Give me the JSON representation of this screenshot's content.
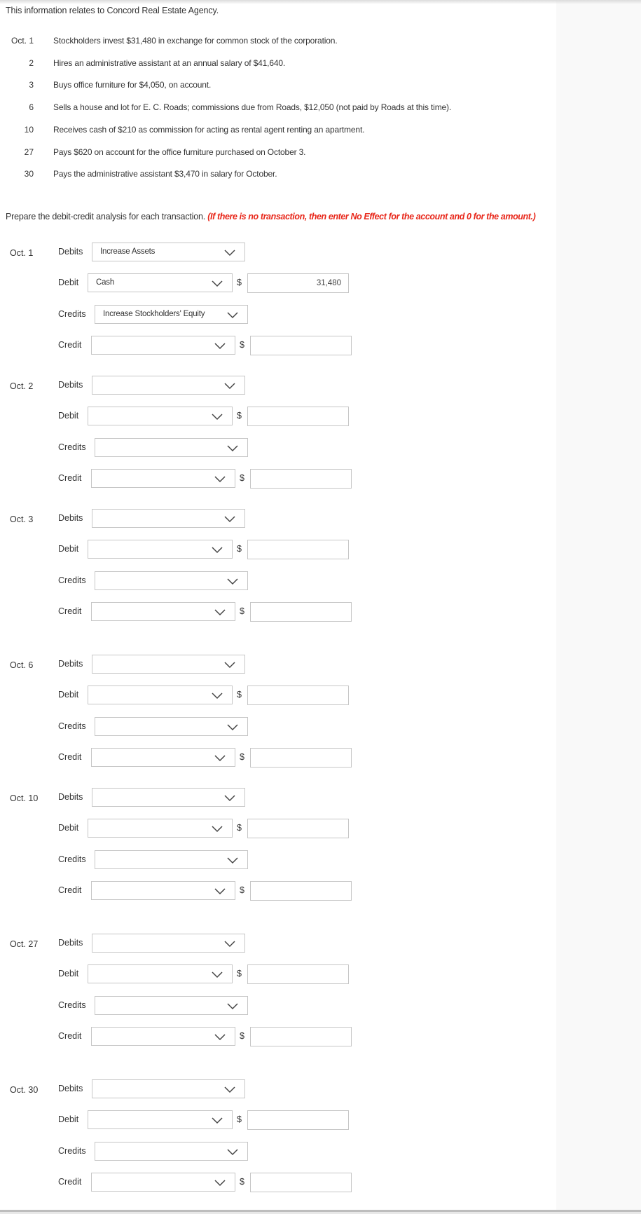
{
  "intro": "This information relates to Concord Real Estate Agency.",
  "transactions": [
    {
      "date": "Oct. 1",
      "description": "Stockholders invest $31,480 in exchange for common stock of the corporation."
    },
    {
      "date": "2",
      "description": "Hires an administrative assistant at an annual salary of $41,640."
    },
    {
      "date": "3",
      "description": "Buys office furniture for $4,050, on account."
    },
    {
      "date": "6",
      "description": "Sells a house and lot for E. C. Roads; commissions due from Roads, $12,050 (not paid by Roads at this time)."
    },
    {
      "date": "10",
      "description": "Receives cash of $210 as commission for acting as rental agent renting an apartment."
    },
    {
      "date": "27",
      "description": "Pays $620 on account for the office furniture purchased on October 3."
    },
    {
      "date": "30",
      "description": "Pays the administrative assistant $3,470 in salary for October."
    }
  ],
  "instructions": {
    "text": "Prepare the debit-credit analysis for each transaction.",
    "note": "(If there is no transaction, then enter No Effect for the account and 0 for the amount.)"
  },
  "labels": {
    "debits": "Debits",
    "debit": "Debit",
    "credits": "Credits",
    "credit": "Credit",
    "currency": "$"
  },
  "sections": [
    {
      "date": "Oct. 1",
      "debits": "Increase Assets",
      "debit_account": "Cash",
      "debit_amount": "31,480",
      "credits": "Increase Stockholders' Equity",
      "credit_account": "",
      "credit_amount": ""
    },
    {
      "date": "Oct. 2",
      "debits": "",
      "debit_account": "",
      "debit_amount": "",
      "credits": "",
      "credit_account": "",
      "credit_amount": ""
    },
    {
      "date": "Oct. 3",
      "debits": "",
      "debit_account": "",
      "debit_amount": "",
      "credits": "",
      "credit_account": "",
      "credit_amount": ""
    },
    {
      "date": "Oct. 6",
      "debits": "",
      "debit_account": "",
      "debit_amount": "",
      "credits": "",
      "credit_account": "",
      "credit_amount": ""
    },
    {
      "date": "Oct. 10",
      "debits": "",
      "debit_account": "",
      "debit_amount": "",
      "credits": "",
      "credit_account": "",
      "credit_amount": ""
    },
    {
      "date": "Oct. 27",
      "debits": "",
      "debit_account": "",
      "debit_amount": "",
      "credits": "",
      "credit_account": "",
      "credit_amount": ""
    },
    {
      "date": "Oct. 30",
      "debits": "",
      "debit_account": "",
      "debit_amount": "",
      "credits": "",
      "credit_account": "",
      "credit_amount": ""
    }
  ]
}
